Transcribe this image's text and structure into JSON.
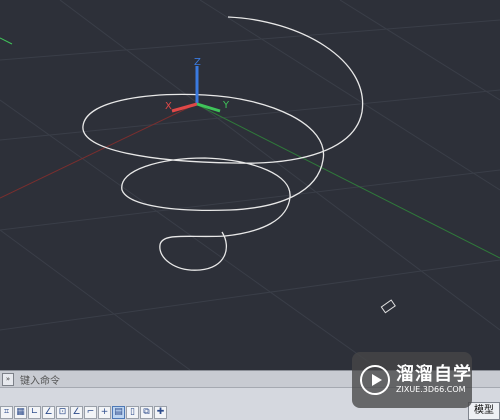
{
  "viewport": {
    "ucs": {
      "z_label": "Z",
      "x_label": "X",
      "y_label": "Y"
    },
    "colors": {
      "background": "#2d3039",
      "helix": "#e8e8e8",
      "x_axis": "#e04848",
      "y_axis": "#3fc45a",
      "z_axis": "#3a7ae0"
    }
  },
  "command_line": {
    "button_label": "»",
    "prompt": "键入命令"
  },
  "toolbar": {
    "icons": [
      "snap-icon",
      "grid-icon",
      "ortho-icon",
      "polar-icon",
      "osnap-icon",
      "otrack-icon",
      "ducs-icon",
      "dyn-icon",
      "lineweight-icon",
      "quickprops-icon",
      "selection-cycling-icon",
      "annotation-icon"
    ]
  },
  "status": {
    "model_tab": "模型"
  },
  "watermark": {
    "title": "溜溜自学",
    "subtitle": "ZIXUE.3D66.COM"
  }
}
